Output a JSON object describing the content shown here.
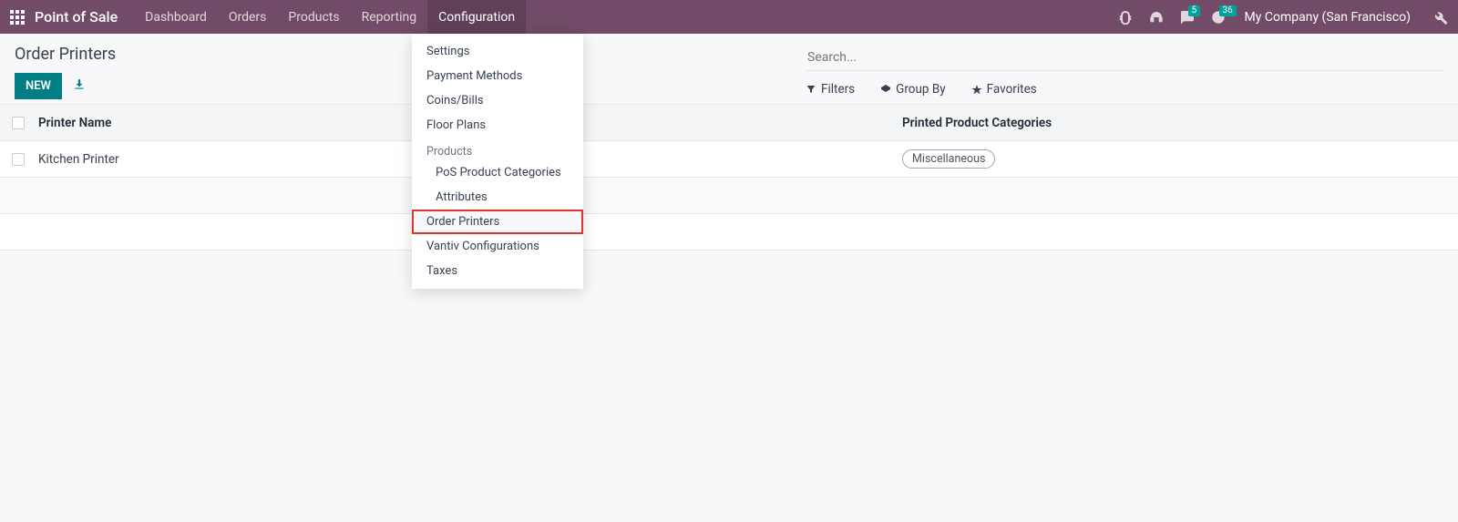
{
  "topnav": {
    "brand": "Point of Sale",
    "items": [
      "Dashboard",
      "Orders",
      "Products",
      "Reporting",
      "Configuration"
    ],
    "active_index": 4,
    "messages_badge": "5",
    "activities_badge": "36",
    "company": "My Company (San Francisco)"
  },
  "dropdown": {
    "items_top": [
      "Settings",
      "Payment Methods",
      "Coins/Bills",
      "Floor Plans"
    ],
    "section_label": "Products",
    "items_sub": [
      "PoS Product Categories",
      "Attributes"
    ],
    "items_bottom": [
      "Order Printers",
      "Vantiv Configurations",
      "Taxes"
    ],
    "highlight_index": 0
  },
  "page": {
    "title": "Order Printers",
    "new_button": "NEW"
  },
  "search": {
    "placeholder": "Search...",
    "filters_label": "Filters",
    "groupby_label": "Group By",
    "favorites_label": "Favorites"
  },
  "table": {
    "col_printer": "Printer Name",
    "col_categories": "Printed Product Categories",
    "rows": [
      {
        "name": "Kitchen Printer",
        "category_tag": "Miscellaneous"
      }
    ]
  }
}
